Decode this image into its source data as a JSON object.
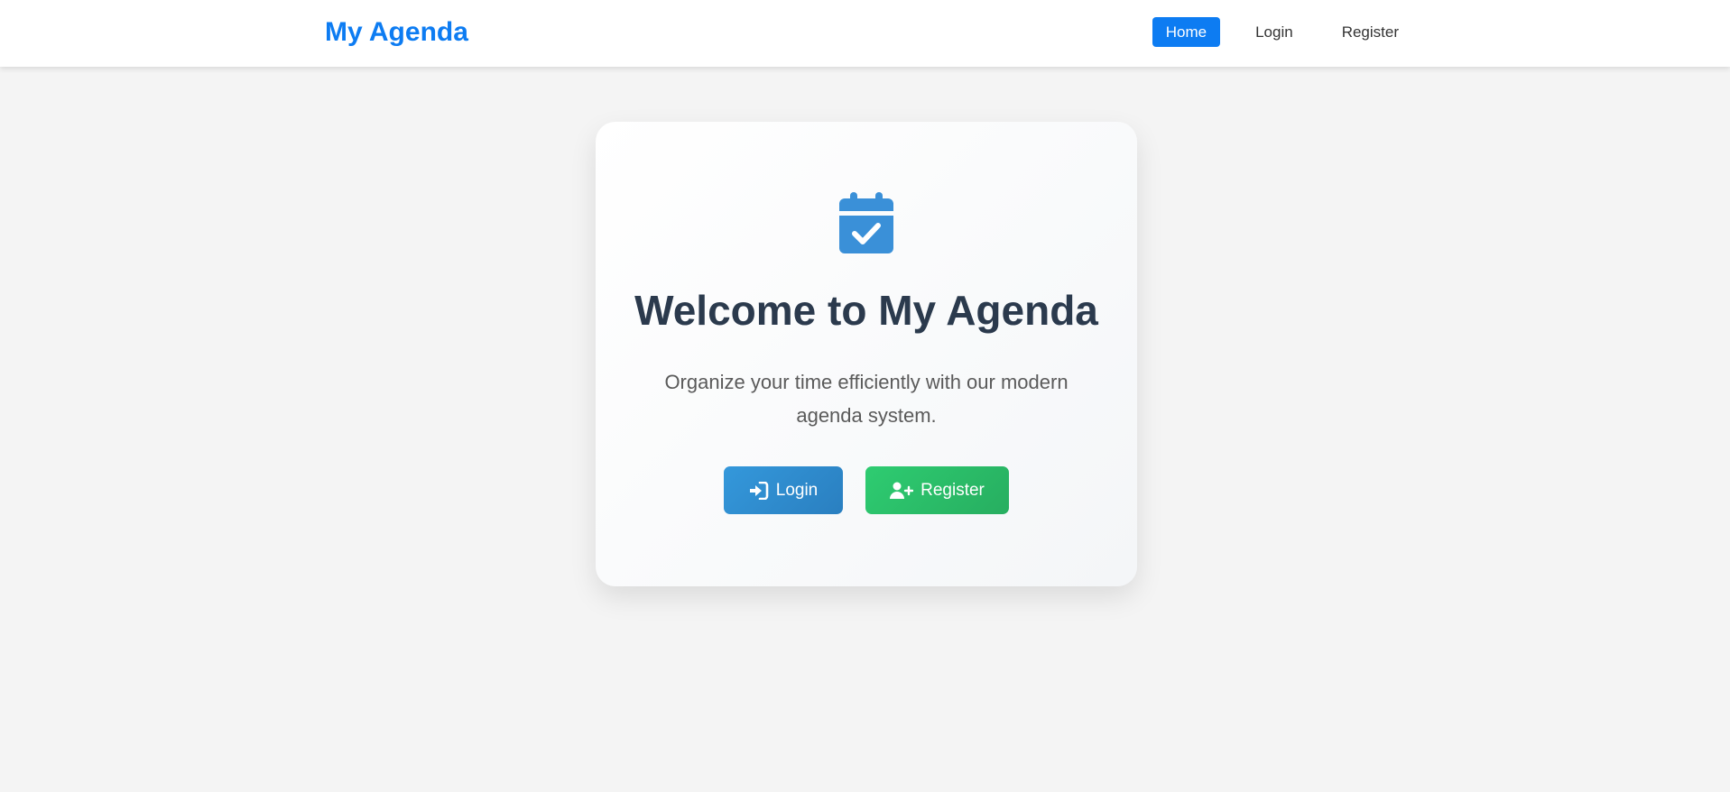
{
  "navbar": {
    "brand": "My Agenda",
    "links": [
      {
        "label": "Home",
        "active": true
      },
      {
        "label": "Login",
        "active": false
      },
      {
        "label": "Register",
        "active": false
      }
    ]
  },
  "hero": {
    "icon": "calendar-check-icon",
    "title": "Welcome to My Agenda",
    "subtitle": "Organize your time efficiently with our modern agenda system.",
    "buttons": {
      "login": {
        "label": "Login",
        "icon": "sign-in-icon"
      },
      "register": {
        "label": "Register",
        "icon": "user-plus-icon"
      }
    }
  },
  "colors": {
    "brand": "#0d7cf2",
    "login_button": "#3498db",
    "register_button": "#2ecc71",
    "title": "#2b3a4d",
    "background": "#f4f4f4"
  }
}
